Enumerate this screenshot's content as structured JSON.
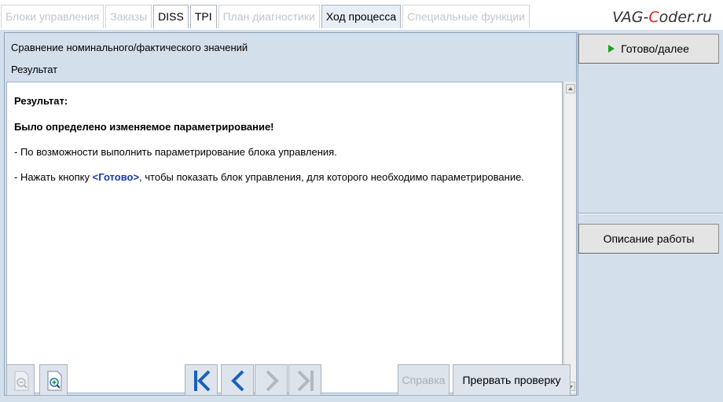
{
  "tabs": [
    {
      "label": "Блоки управления",
      "state": "disabled"
    },
    {
      "label": "Заказы",
      "state": "disabled"
    },
    {
      "label": "DISS",
      "state": "enabled"
    },
    {
      "label": "TPI",
      "state": "enabled"
    },
    {
      "label": "План диагностики",
      "state": "disabled"
    },
    {
      "label": "Ход процесса",
      "state": "selected"
    },
    {
      "label": "Специальные функции",
      "state": "disabled"
    }
  ],
  "watermark": {
    "pre": "VAG-",
    "c": "C",
    "post": "oder.ru"
  },
  "header": {
    "title": "Сравнение номинального/фактического значений",
    "subtitle": "Результат"
  },
  "content": {
    "heading": "Результат:",
    "message": "Было определено изменяемое параметрирование!",
    "line1": "- По возможности выполнить параметрирование блока управления.",
    "line2_pre": "- Нажать кнопку ",
    "line2_button": "<Готово>",
    "line2_post": ", чтобы показать блок управления, для которого необходимо параметрирование."
  },
  "toolbar": {
    "help_label": "Справка",
    "abort_label": "Прервать проверку"
  },
  "right_panel": {
    "next_label": "Готово/далее",
    "description_label": "Описание работы"
  },
  "icons": {
    "zoom_out": "zoom-out-icon",
    "zoom_in": "zoom-in-icon",
    "first": "skip-first-icon",
    "prev": "chevron-left-icon",
    "next": "chevron-right-icon",
    "last": "skip-last-icon",
    "play": "play-icon"
  },
  "colors": {
    "accent_blue": "#1a5fc0",
    "play_green": "#1fa11f",
    "button_ref": "#1a3aa8"
  }
}
